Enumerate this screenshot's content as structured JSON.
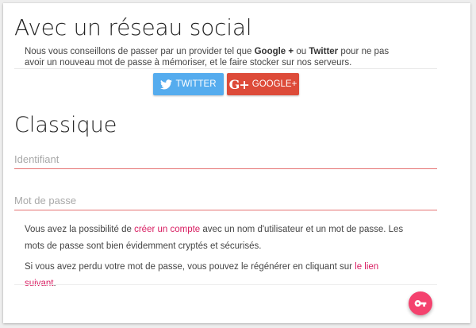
{
  "social": {
    "title": "Avec un réseau social",
    "intro": {
      "part1": "Nous vous conseillons de passer par un provider tel que ",
      "google": "Google +",
      "part2": " ou ",
      "twitter": "Twitter",
      "part3": " pour ne pas avoir un nouveau mot de passe à mémoriser, et le faire stocker sur nos serveurs."
    },
    "twitter_button": "TWITTER",
    "google_button": "GOOGLE+",
    "google_glyph": "g+"
  },
  "classic": {
    "title": "Classique",
    "username_placeholder": "Identifiant",
    "username_value": "",
    "password_placeholder": "Mot de passe",
    "password_value": "",
    "info1": {
      "part1": "Vous avez la possibilité de ",
      "link": "créer un compte",
      "part2": " avec un nom d'utilisateur et un mot de passe. Les mots de passe sont bien évidemment cryptés et sécurisés."
    },
    "info2": {
      "part1": "Si vous avez perdu votre mot de passe, vous pouvez le régénérer en cliquant sur ",
      "link": "le lien suivant",
      "part2": "."
    }
  },
  "icons": {
    "twitter": "twitter-icon",
    "google": "google-plus-icon",
    "login": "key-icon"
  },
  "colors": {
    "twitter": "#55acee",
    "google": "#dd4b39",
    "accent": "#f4426e",
    "link": "#d81b60",
    "field_underline": "#e57373"
  }
}
